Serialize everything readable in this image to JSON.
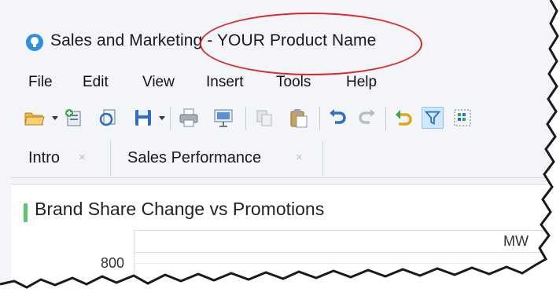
{
  "window": {
    "title_app": "Sales and Marketing",
    "title_separator": " - ",
    "title_product": "YOUR Product Name"
  },
  "menu": {
    "items": [
      "File",
      "Edit",
      "View",
      "Insert",
      "Tools",
      "Help"
    ]
  },
  "toolbar": {
    "icons": [
      "open-folder-icon",
      "add-report-icon",
      "refresh-icon",
      "save-icon",
      "print-icon",
      "present-icon",
      "copy-icon",
      "paste-icon",
      "undo-icon",
      "redo-icon",
      "reset-icon",
      "filter-icon",
      "grid-icon"
    ]
  },
  "tabs": [
    {
      "label": "Intro",
      "close": "×"
    },
    {
      "label": "Sales Performance",
      "close": "×"
    }
  ],
  "chart": {
    "title": "Brand Share Change vs Promotions",
    "series_header": "MW",
    "y_tick": "800"
  },
  "colors": {
    "annotation_oval": "#d9282c",
    "title_marker": "#5cc66e",
    "active_tool": "#cfe8fb"
  }
}
